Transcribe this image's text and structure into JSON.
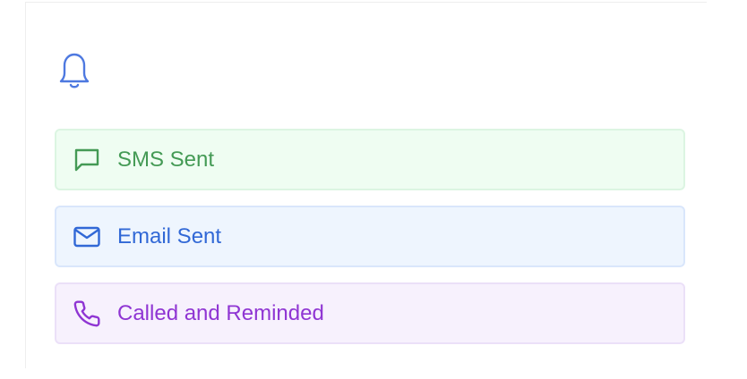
{
  "colors": {
    "bell": "#4e79e0",
    "sms": "#449a55",
    "email": "#3168d6",
    "call": "#8f35d3"
  },
  "header": {
    "icon": "bell-icon"
  },
  "reminders": [
    {
      "label": "SMS Sent",
      "icon": "message-square-icon"
    },
    {
      "label": "Email Sent",
      "icon": "mail-icon"
    },
    {
      "label": "Called and Reminded",
      "icon": "phone-icon"
    }
  ]
}
